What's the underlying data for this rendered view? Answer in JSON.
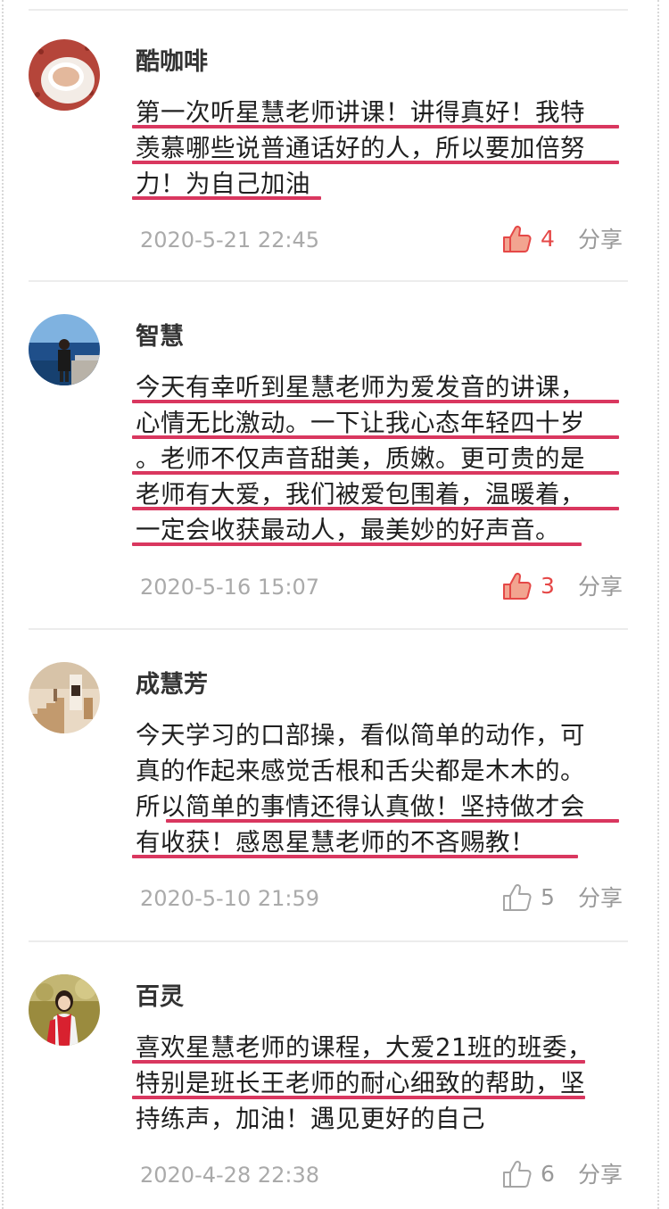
{
  "comments": [
    {
      "name": "酷咖啡",
      "lines": [
        "第一次听星慧老师讲课！讲得真好！我特",
        "羡慕哪些说普通话好的人，所以要加倍努",
        "力！为自己加油"
      ],
      "time": "2020-5-21 22:45",
      "likes": "4",
      "liked": true,
      "share": "分享",
      "avatar_icon": "coffee-cup-avatar"
    },
    {
      "name": "智慧",
      "lines": [
        "今天有幸听到星慧老师为爱发音的讲课，",
        "心情无比激动。一下让我心态年轻四十岁",
        "。老师不仅声音甜美，质嫩。更可贵的是",
        "老师有大爱，我们被爱包围着，温暖着，",
        "一定会收获最动人，最美妙的好声音。"
      ],
      "time": "2020-5-16 15:07",
      "likes": "3",
      "liked": true,
      "share": "分享",
      "avatar_icon": "sea-person-avatar"
    },
    {
      "name": "成慧芳",
      "lines": [
        "今天学习的口部操，看似简单的动作，可",
        "真的作起来感觉舌根和舌尖都是木木的。",
        "所以简单的事情还得认真做！坚持做才会",
        "有收获！感恩星慧老师的不吝赐教！"
      ],
      "time": "2020-5-10 21:59",
      "likes": "5",
      "liked": false,
      "share": "分享",
      "avatar_icon": "staircase-avatar"
    },
    {
      "name": "百灵",
      "lines": [
        "喜欢星慧老师的课程，大爱21班的班委，",
        "特别是班长王老师的耐心细致的帮助，坚",
        "持练声，加油！遇见更好的自己"
      ],
      "time": "2020-4-28 22:38",
      "likes": "6",
      "liked": false,
      "share": "分享",
      "avatar_icon": "woman-red-scarf-avatar"
    }
  ],
  "colors": {
    "underline": "#d9375f",
    "liked": "#e54847",
    "muted": "#999999"
  }
}
